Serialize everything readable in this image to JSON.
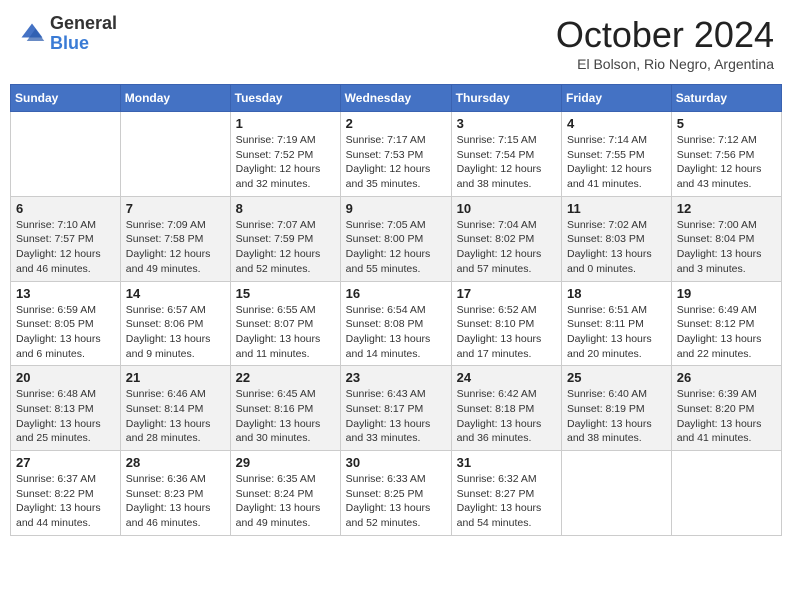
{
  "header": {
    "logo_general": "General",
    "logo_blue": "Blue",
    "month_title": "October 2024",
    "subtitle": "El Bolson, Rio Negro, Argentina"
  },
  "days_of_week": [
    "Sunday",
    "Monday",
    "Tuesday",
    "Wednesday",
    "Thursday",
    "Friday",
    "Saturday"
  ],
  "weeks": [
    [
      {
        "day": "",
        "info": ""
      },
      {
        "day": "",
        "info": ""
      },
      {
        "day": "1",
        "info": "Sunrise: 7:19 AM\nSunset: 7:52 PM\nDaylight: 12 hours and 32 minutes."
      },
      {
        "day": "2",
        "info": "Sunrise: 7:17 AM\nSunset: 7:53 PM\nDaylight: 12 hours and 35 minutes."
      },
      {
        "day": "3",
        "info": "Sunrise: 7:15 AM\nSunset: 7:54 PM\nDaylight: 12 hours and 38 minutes."
      },
      {
        "day": "4",
        "info": "Sunrise: 7:14 AM\nSunset: 7:55 PM\nDaylight: 12 hours and 41 minutes."
      },
      {
        "day": "5",
        "info": "Sunrise: 7:12 AM\nSunset: 7:56 PM\nDaylight: 12 hours and 43 minutes."
      }
    ],
    [
      {
        "day": "6",
        "info": "Sunrise: 7:10 AM\nSunset: 7:57 PM\nDaylight: 12 hours and 46 minutes."
      },
      {
        "day": "7",
        "info": "Sunrise: 7:09 AM\nSunset: 7:58 PM\nDaylight: 12 hours and 49 minutes."
      },
      {
        "day": "8",
        "info": "Sunrise: 7:07 AM\nSunset: 7:59 PM\nDaylight: 12 hours and 52 minutes."
      },
      {
        "day": "9",
        "info": "Sunrise: 7:05 AM\nSunset: 8:00 PM\nDaylight: 12 hours and 55 minutes."
      },
      {
        "day": "10",
        "info": "Sunrise: 7:04 AM\nSunset: 8:02 PM\nDaylight: 12 hours and 57 minutes."
      },
      {
        "day": "11",
        "info": "Sunrise: 7:02 AM\nSunset: 8:03 PM\nDaylight: 13 hours and 0 minutes."
      },
      {
        "day": "12",
        "info": "Sunrise: 7:00 AM\nSunset: 8:04 PM\nDaylight: 13 hours and 3 minutes."
      }
    ],
    [
      {
        "day": "13",
        "info": "Sunrise: 6:59 AM\nSunset: 8:05 PM\nDaylight: 13 hours and 6 minutes."
      },
      {
        "day": "14",
        "info": "Sunrise: 6:57 AM\nSunset: 8:06 PM\nDaylight: 13 hours and 9 minutes."
      },
      {
        "day": "15",
        "info": "Sunrise: 6:55 AM\nSunset: 8:07 PM\nDaylight: 13 hours and 11 minutes."
      },
      {
        "day": "16",
        "info": "Sunrise: 6:54 AM\nSunset: 8:08 PM\nDaylight: 13 hours and 14 minutes."
      },
      {
        "day": "17",
        "info": "Sunrise: 6:52 AM\nSunset: 8:10 PM\nDaylight: 13 hours and 17 minutes."
      },
      {
        "day": "18",
        "info": "Sunrise: 6:51 AM\nSunset: 8:11 PM\nDaylight: 13 hours and 20 minutes."
      },
      {
        "day": "19",
        "info": "Sunrise: 6:49 AM\nSunset: 8:12 PM\nDaylight: 13 hours and 22 minutes."
      }
    ],
    [
      {
        "day": "20",
        "info": "Sunrise: 6:48 AM\nSunset: 8:13 PM\nDaylight: 13 hours and 25 minutes."
      },
      {
        "day": "21",
        "info": "Sunrise: 6:46 AM\nSunset: 8:14 PM\nDaylight: 13 hours and 28 minutes."
      },
      {
        "day": "22",
        "info": "Sunrise: 6:45 AM\nSunset: 8:16 PM\nDaylight: 13 hours and 30 minutes."
      },
      {
        "day": "23",
        "info": "Sunrise: 6:43 AM\nSunset: 8:17 PM\nDaylight: 13 hours and 33 minutes."
      },
      {
        "day": "24",
        "info": "Sunrise: 6:42 AM\nSunset: 8:18 PM\nDaylight: 13 hours and 36 minutes."
      },
      {
        "day": "25",
        "info": "Sunrise: 6:40 AM\nSunset: 8:19 PM\nDaylight: 13 hours and 38 minutes."
      },
      {
        "day": "26",
        "info": "Sunrise: 6:39 AM\nSunset: 8:20 PM\nDaylight: 13 hours and 41 minutes."
      }
    ],
    [
      {
        "day": "27",
        "info": "Sunrise: 6:37 AM\nSunset: 8:22 PM\nDaylight: 13 hours and 44 minutes."
      },
      {
        "day": "28",
        "info": "Sunrise: 6:36 AM\nSunset: 8:23 PM\nDaylight: 13 hours and 46 minutes."
      },
      {
        "day": "29",
        "info": "Sunrise: 6:35 AM\nSunset: 8:24 PM\nDaylight: 13 hours and 49 minutes."
      },
      {
        "day": "30",
        "info": "Sunrise: 6:33 AM\nSunset: 8:25 PM\nDaylight: 13 hours and 52 minutes."
      },
      {
        "day": "31",
        "info": "Sunrise: 6:32 AM\nSunset: 8:27 PM\nDaylight: 13 hours and 54 minutes."
      },
      {
        "day": "",
        "info": ""
      },
      {
        "day": "",
        "info": ""
      }
    ]
  ]
}
